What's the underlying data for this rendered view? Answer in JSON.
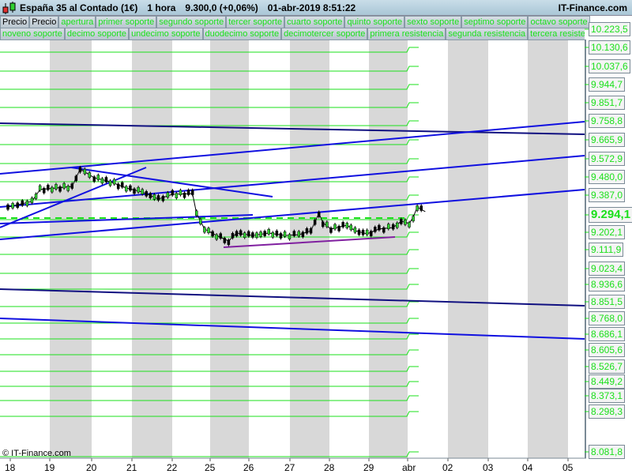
{
  "title": {
    "instrument": "España 35 al Contado (1€)",
    "timeframe": "1 hora",
    "price": "9.300,0 (+0,06%)",
    "datetime": "01-abr-2019 8:51:22",
    "brand": "IT-Finance.com"
  },
  "legend_row1": [
    "Precio",
    "Precio",
    "apertura",
    "primer soporte",
    "segundo soporte",
    "tercer soporte",
    "cuarto soporte",
    "quinto soporte",
    "sexto soporte",
    "septimo soporte",
    "octavo soporte"
  ],
  "legend_row2": [
    "noveno soporte",
    "decimo soporte",
    "undecimo soporte",
    "duodecimo soporte",
    "decimotercer soporte",
    "primera resistencia",
    "segunda resistencia",
    "tercera resistencia"
  ],
  "price_levels": [
    "10.223,5",
    "10.130,6",
    "10.037,6",
    "9.944,7",
    "9.851,7",
    "9.758,8",
    "9.665,9",
    "9.572,9",
    "9.480,0",
    "9.387,0",
    "9.294,1",
    "9.202,1",
    "9.111,9",
    "9.023,4",
    "8.936,6",
    "8.851,5",
    "8.768,0",
    "8.686,1",
    "8.605,6",
    "8.526,7",
    "8.449,2",
    "8.373,1",
    "8.298,3",
    "8.081,8"
  ],
  "current_price": "9.294,1",
  "days": [
    "18",
    "19",
    "20",
    "21",
    "22",
    "25",
    "26",
    "27",
    "28",
    "29",
    "abr",
    "02",
    "03",
    "04",
    "05"
  ],
  "copyright": "© IT-Finance.com",
  "price_path": [
    [
      0,
      9335
    ],
    [
      0.6,
      9365
    ],
    [
      0.8,
      9427
    ],
    [
      1.2,
      9435
    ],
    [
      1.6,
      9443
    ],
    [
      1.8,
      9534
    ],
    [
      2.15,
      9489
    ],
    [
      2.55,
      9468
    ],
    [
      2.95,
      9435
    ],
    [
      3.35,
      9414
    ],
    [
      3.75,
      9377
    ],
    [
      4.1,
      9402
    ],
    [
      4.6,
      9406
    ],
    [
      4.7,
      9302
    ],
    [
      4.9,
      9220
    ],
    [
      5.2,
      9186
    ],
    [
      5.5,
      9157
    ],
    [
      5.7,
      9199
    ],
    [
      6.1,
      9186
    ],
    [
      6.5,
      9199
    ],
    [
      6.9,
      9186
    ],
    [
      7.25,
      9190
    ],
    [
      7.55,
      9211
    ],
    [
      7.75,
      9302
    ],
    [
      7.85,
      9253
    ],
    [
      8.05,
      9220
    ],
    [
      8.45,
      9240
    ],
    [
      8.65,
      9211
    ],
    [
      8.95,
      9195
    ],
    [
      9.25,
      9220
    ],
    [
      9.6,
      9228
    ],
    [
      9.8,
      9261
    ],
    [
      10.0,
      9249
    ],
    [
      10.1,
      9282
    ],
    [
      10.2,
      9335
    ],
    [
      10.4,
      9311
    ]
  ],
  "colors": {
    "support": "#1be01b",
    "trendline": "#1010e0",
    "trendline_dark": "#101080",
    "channel": "#8020a0"
  }
}
